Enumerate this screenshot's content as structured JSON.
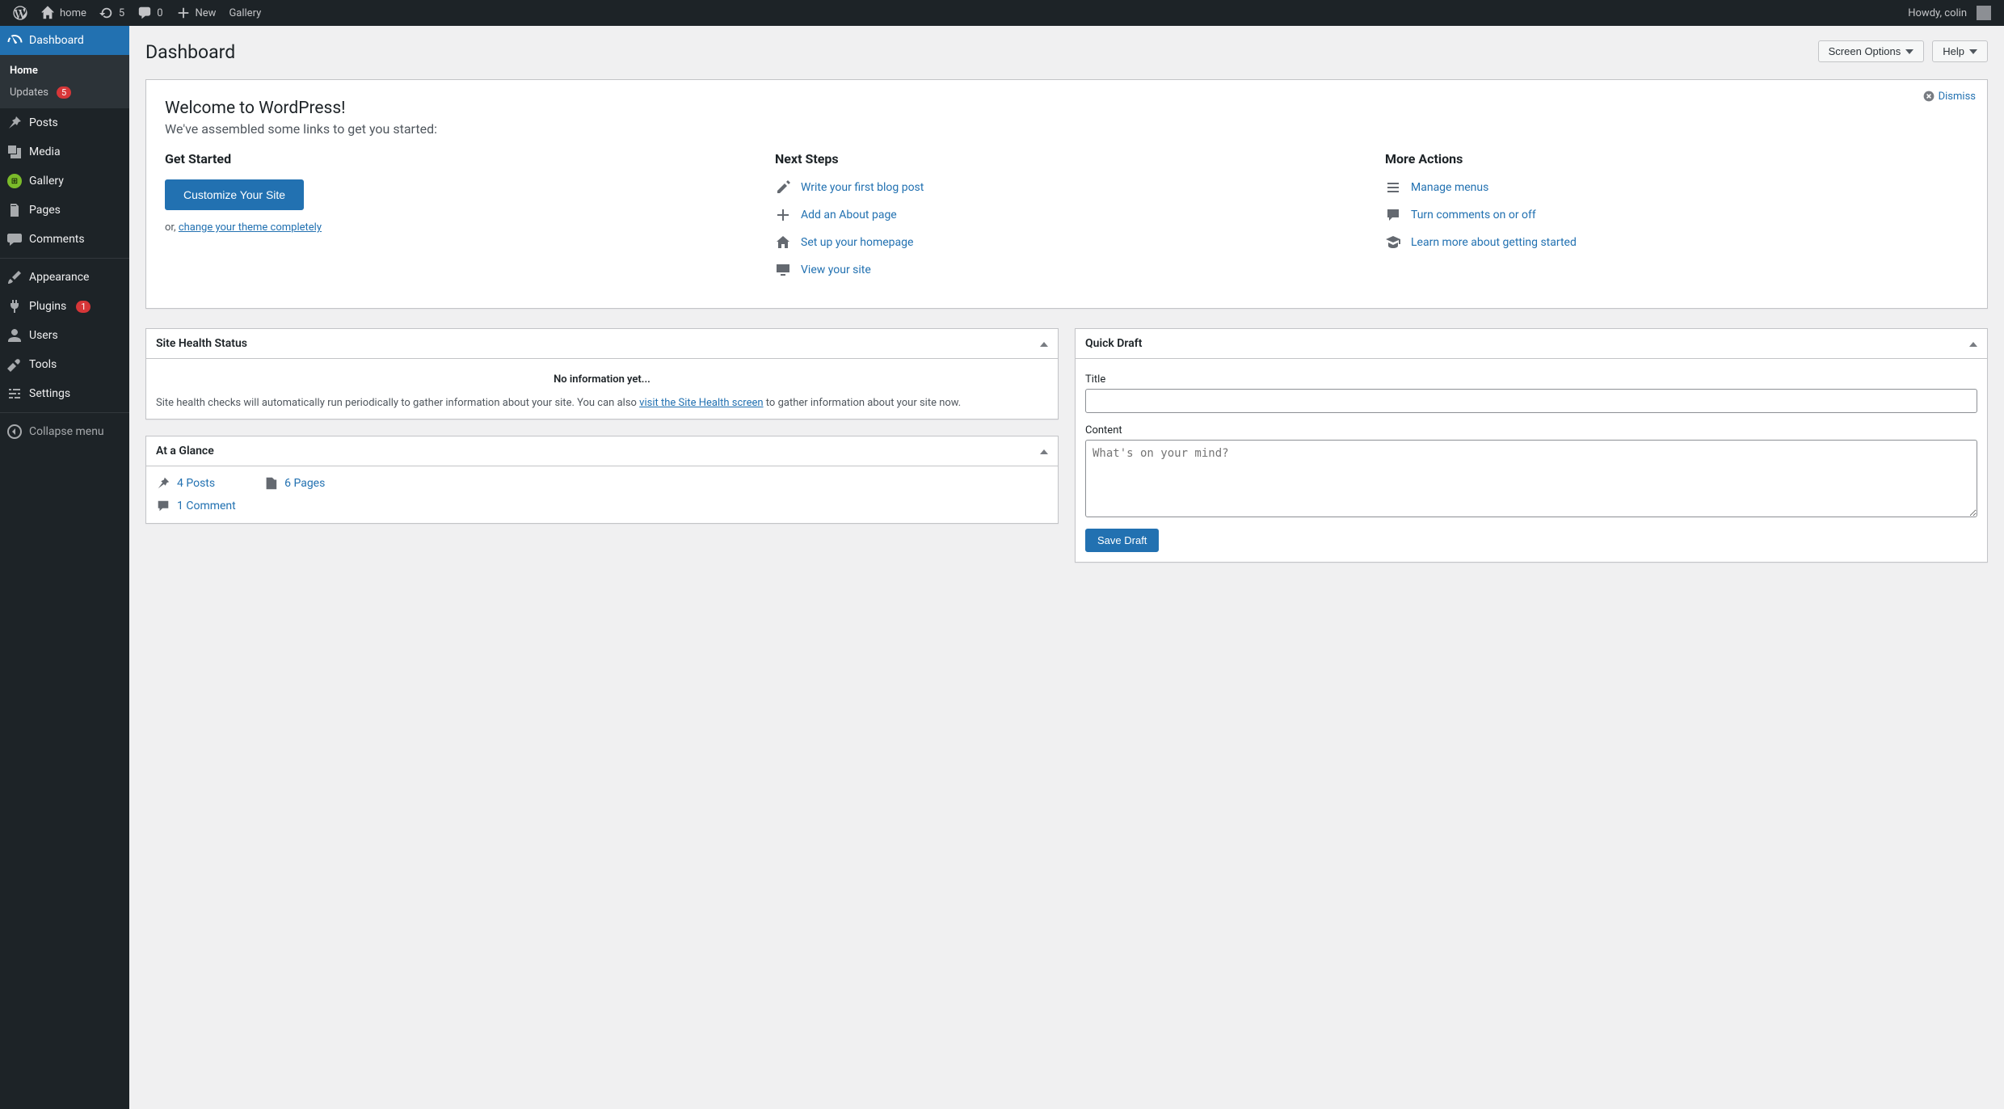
{
  "adminbar": {
    "site_name": "home",
    "updates_count": "5",
    "comments_count": "0",
    "new_label": "New",
    "gallery_label": "Gallery",
    "howdy": "Howdy, colin"
  },
  "sidebar": {
    "dashboard": "Dashboard",
    "home": "Home",
    "updates": "Updates",
    "updates_badge": "5",
    "posts": "Posts",
    "media": "Media",
    "gallery": "Gallery",
    "pages": "Pages",
    "comments": "Comments",
    "appearance": "Appearance",
    "plugins": "Plugins",
    "plugins_badge": "1",
    "users": "Users",
    "tools": "Tools",
    "settings": "Settings",
    "collapse": "Collapse menu"
  },
  "page": {
    "screen_options": "Screen Options",
    "help": "Help",
    "title": "Dashboard"
  },
  "welcome": {
    "title": "Welcome to WordPress!",
    "subtitle": "We've assembled some links to get you started:",
    "dismiss": "Dismiss",
    "col1_title": "Get Started",
    "customize_btn": "Customize Your Site",
    "or_prefix": "or, ",
    "or_link": "change your theme completely",
    "col2_title": "Next Steps",
    "write_post": "Write your first blog post",
    "add_about": "Add an About page",
    "setup_home": "Set up your homepage",
    "view_site": "View your site",
    "col3_title": "More Actions",
    "manage_menus": "Manage menus",
    "toggle_comments": "Turn comments on or off",
    "learn_more": "Learn more about getting started"
  },
  "site_health": {
    "title": "Site Health Status",
    "no_info": "No information yet...",
    "text_a": "Site health checks will automatically run periodically to gather information about your site. You can also ",
    "link": "visit the Site Health screen",
    "text_b": " to gather information about your site now."
  },
  "glance": {
    "title": "At a Glance",
    "posts": "4 Posts",
    "pages": "6 Pages",
    "comments": "1 Comment"
  },
  "quick_draft": {
    "title": "Quick Draft",
    "title_label": "Title",
    "content_label": "Content",
    "content_placeholder": "What's on your mind?",
    "save": "Save Draft"
  }
}
